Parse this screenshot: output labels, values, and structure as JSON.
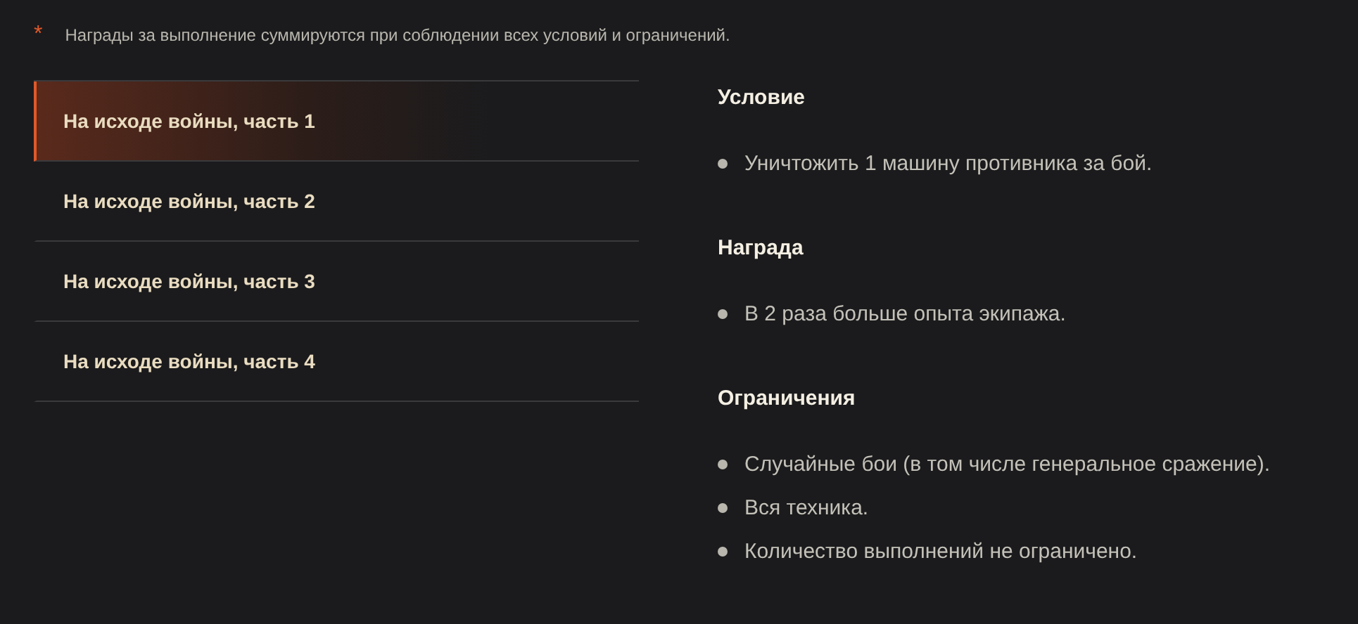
{
  "note": {
    "mark": "*",
    "text": "Награды за выполнение суммируются при соблюдении всех условий и ограничений."
  },
  "tabs": [
    {
      "label": "На исходе войны, часть 1",
      "selected": true
    },
    {
      "label": "На исходе войны, часть 2",
      "selected": false
    },
    {
      "label": "На исходе войны, часть 3",
      "selected": false
    },
    {
      "label": "На исходе войны, часть 4",
      "selected": false
    }
  ],
  "sections": [
    {
      "title": "Условие",
      "items": [
        "Уничтожить 1 машину противника за бой."
      ]
    },
    {
      "title": "Награда",
      "items": [
        "В 2 раза больше опыта экипажа."
      ]
    },
    {
      "title": "Ограничения",
      "items": [
        "Случайные бои (в том числе генеральное сражение).",
        "Вся техника.",
        "Количество выполнений не ограничено."
      ]
    }
  ]
}
